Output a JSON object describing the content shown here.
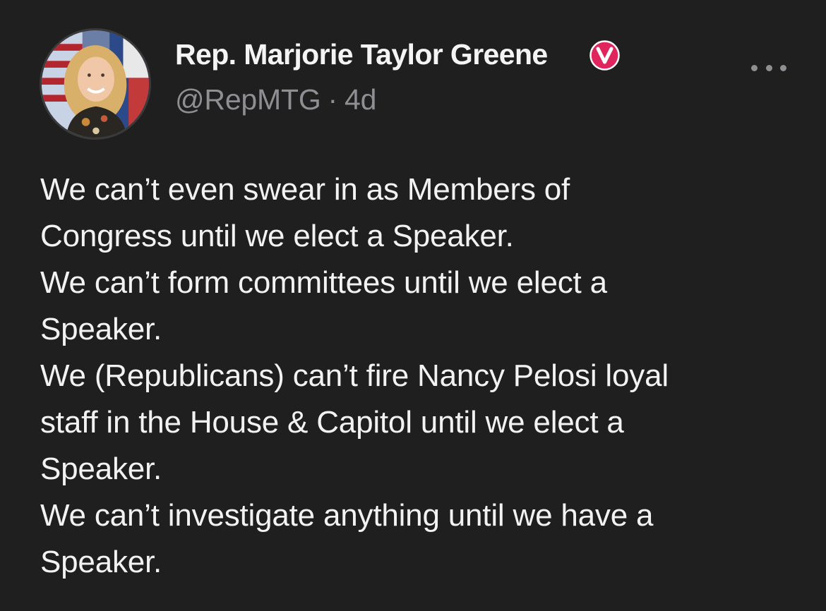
{
  "author": {
    "display_name": "Rep. Marjorie Taylor Greene",
    "verified_badge_letter": "V",
    "verified_badge_color": "#e0245e",
    "handle": "@RepMTG",
    "separator": "·",
    "timestamp": "4d",
    "avatar_icon": "profile-photo"
  },
  "menu": {
    "icon": "more-options-icon"
  },
  "post": {
    "lines": [
      "We can’t even swear in as Members of",
      "Congress until we elect a Speaker.",
      "We can’t form committees until we elect a",
      "Speaker.",
      "We (Republicans) can’t fire Nancy Pelosi loyal",
      "staff in the House & Capitol until we elect a",
      "Speaker.",
      "We can’t investigate anything until we have a",
      "Speaker."
    ]
  },
  "colors": {
    "background": "#1f1f1f",
    "text": "#f2f2f2",
    "secondary_text": "#8e8e93"
  }
}
